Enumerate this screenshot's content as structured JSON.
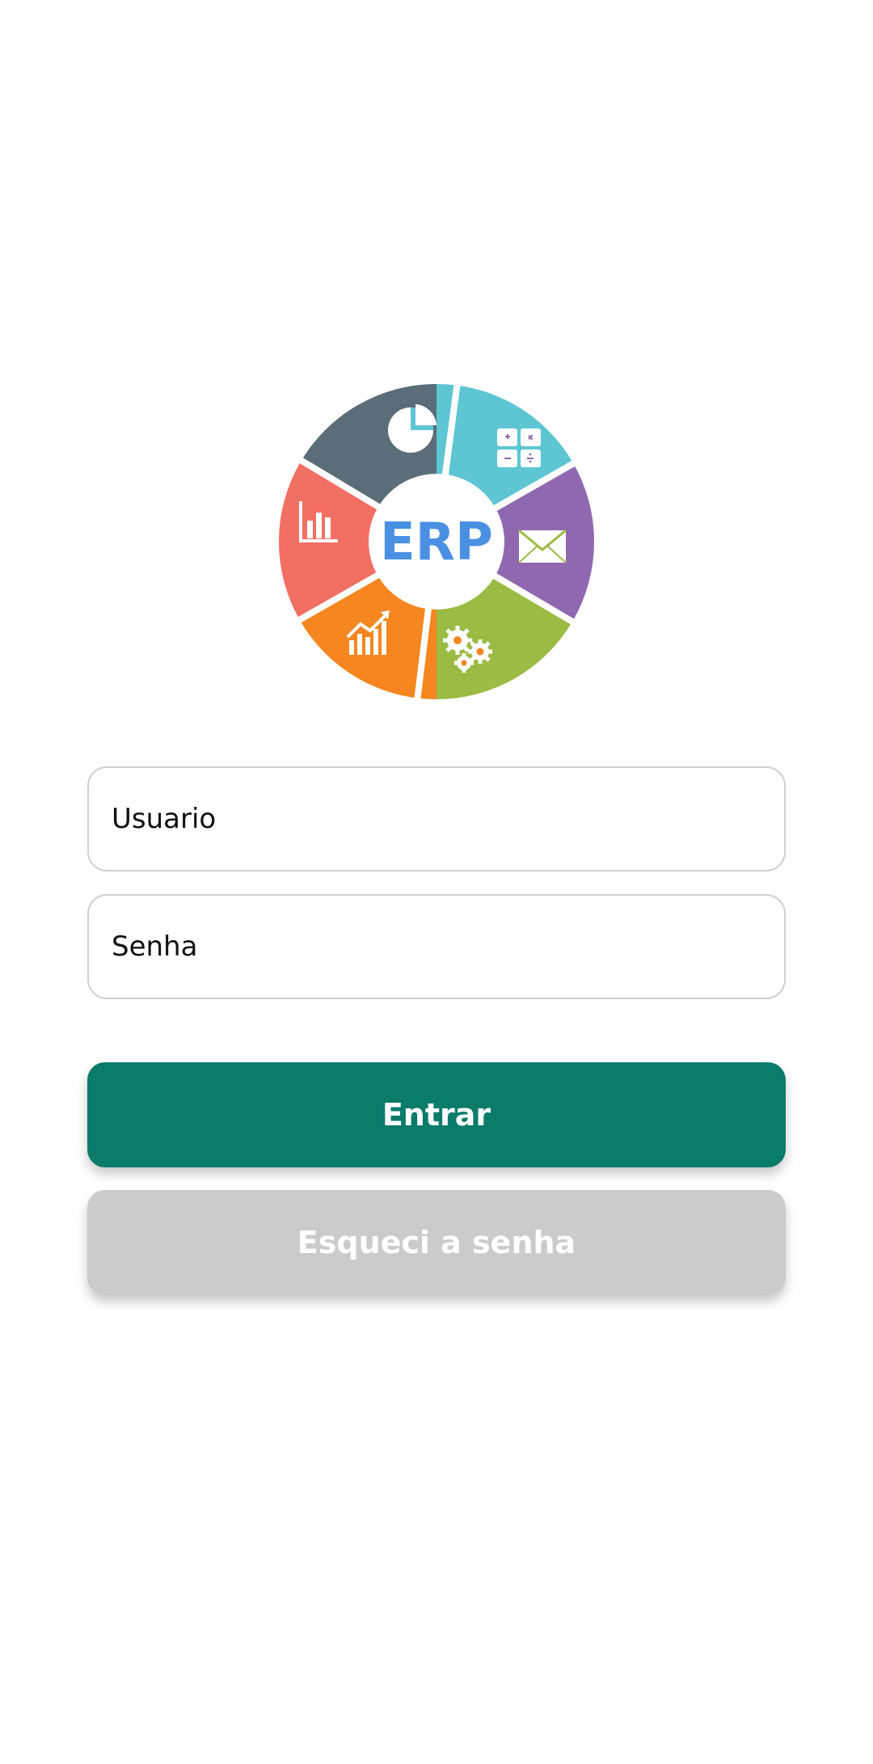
{
  "logo": {
    "text": "ERP",
    "icons": [
      "pie-chart-icon",
      "calculator-icon",
      "envelope-icon",
      "gears-icon",
      "trend-chart-icon",
      "bar-chart-icon"
    ],
    "colors": {
      "teal": "#5ec5d3",
      "purple": "#9068b0",
      "green": "#9bbb44",
      "orange": "#f6861f",
      "coral": "#f26f63",
      "slate": "#5a6d78",
      "text": "#4a90e2"
    }
  },
  "login": {
    "username_placeholder": "Usuario",
    "password_placeholder": "Senha",
    "submit_label": "Entrar",
    "forgot_label": "Esqueci a senha"
  },
  "colors": {
    "primary": "#0b7b6a",
    "secondary": "#cbcbcb"
  }
}
